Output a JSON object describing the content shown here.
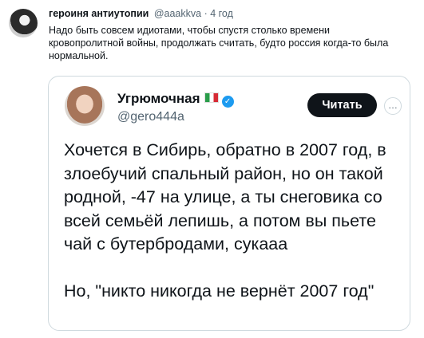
{
  "outer_post": {
    "author_name": "героиня антиутопии",
    "handle_time": "@aaakkva · 4 год",
    "text": "Надо быть совсем идиотами, чтобы спустя столько времени кровопролитной войны, продолжать считать, будто россия когда-то была нормальной."
  },
  "embedded_post": {
    "author_name": "Угрюмочная",
    "flag_icon": "italy-flag-icon",
    "handle": "@gero444a",
    "follow_label": "Читать",
    "paragraph_1": "Хочется в Сибирь, обратно в 2007 год, в злоебучий спальный район, но он такой родной, -47 на улице, а ты снеговика со всей семьёй лепишь, а потом вы пьете чай с бутербродами, сукааа",
    "paragraph_2": "Но, \"никто никогда не вернёт 2007 год\""
  },
  "colors": {
    "accent": "#1d9bf0",
    "button": "#0f1419",
    "muted": "#536471",
    "border": "#cfd9de"
  }
}
